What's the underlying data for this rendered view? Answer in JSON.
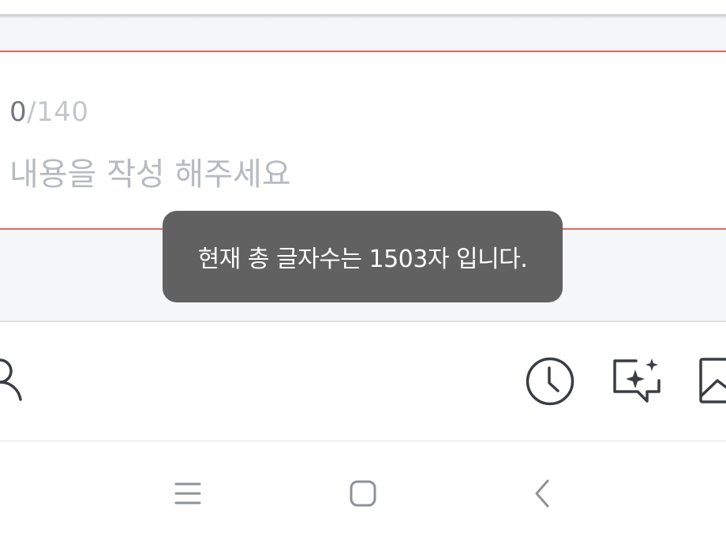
{
  "editor": {
    "counter_current": "0",
    "counter_max": "/140",
    "placeholder": "내용을 작성 해주세요",
    "value": ""
  },
  "toast": {
    "message": "현재 총 글자수는 1503자 입니다."
  },
  "toolbar": {
    "icons": [
      "person-icon",
      "clock-icon",
      "ai-chat-icon",
      "image-icon"
    ]
  },
  "navbar": {
    "icons": [
      "recent-apps-icon",
      "home-icon",
      "back-icon"
    ]
  },
  "colors": {
    "accent_border": "#e2675f",
    "toast_bg": "#616161",
    "band_bg": "#f5f6f8",
    "icon_stroke": "#3a3d42"
  }
}
